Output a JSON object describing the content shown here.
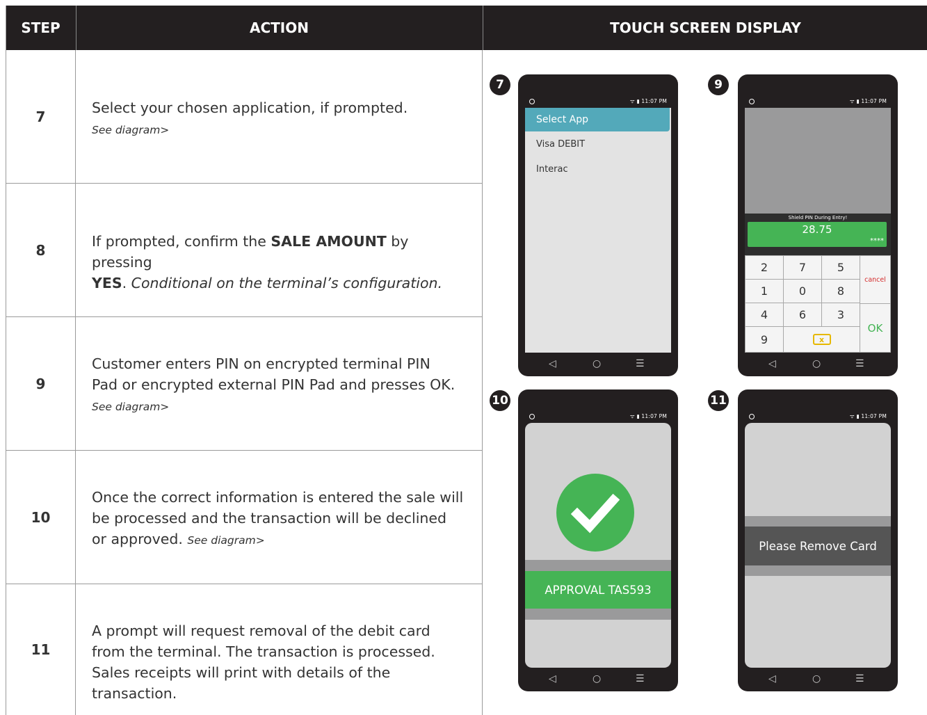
{
  "header": {
    "step": "STEP",
    "action": "ACTION",
    "display": "TOUCH SCREEN DISPLAY"
  },
  "rows": [
    {
      "step": "7",
      "text": "Select your chosen application, if prompted.",
      "note": "See diagram>"
    },
    {
      "step": "8",
      "text_pre": "If prompted, confirm the ",
      "bold1": "SALE AMOUNT",
      "text_mid": " by pressing",
      "bold2": "YES",
      "text_dot": ". ",
      "cond": "Conditional on the terminal’s configuration."
    },
    {
      "step": "9",
      "text": "Customer enters PIN on encrypted terminal PIN Pad or encrypted external PIN Pad and presses OK.",
      "note": "See diagram>"
    },
    {
      "step": "10",
      "text": "Once the correct information is entered the sale will be processed and the transaction will be declined or approved.",
      "note": "See diagram>"
    },
    {
      "step": "11",
      "text": "A prompt will request removal of the debit card from the terminal. The transaction is processed. Sales receipts will print with details of the transaction."
    }
  ],
  "phones": {
    "time": "11:07 PM",
    "nav": {
      "back": "◁",
      "home": "○",
      "menu": "☰"
    },
    "p7": {
      "badge": "7",
      "title": "Select App",
      "options": [
        "Visa DEBIT",
        "Interac"
      ]
    },
    "p9": {
      "badge": "9",
      "shield": "Shield PIN During Entry!",
      "amount": "28.75",
      "masked": "****",
      "keys": [
        "2",
        "7",
        "5",
        "1",
        "0",
        "8",
        "4",
        "6",
        "3",
        "9"
      ],
      "cancel": "cancel",
      "ok": "OK",
      "backspace": "x"
    },
    "p10": {
      "badge": "10",
      "message": "APPROVAL TAS593"
    },
    "p11": {
      "badge": "11",
      "message": "Please Remove Card"
    }
  },
  "colors": {
    "header": "#231f20",
    "teal": "#53a9ba",
    "green": "#45b455",
    "cancel_red": "#d42d2d"
  }
}
